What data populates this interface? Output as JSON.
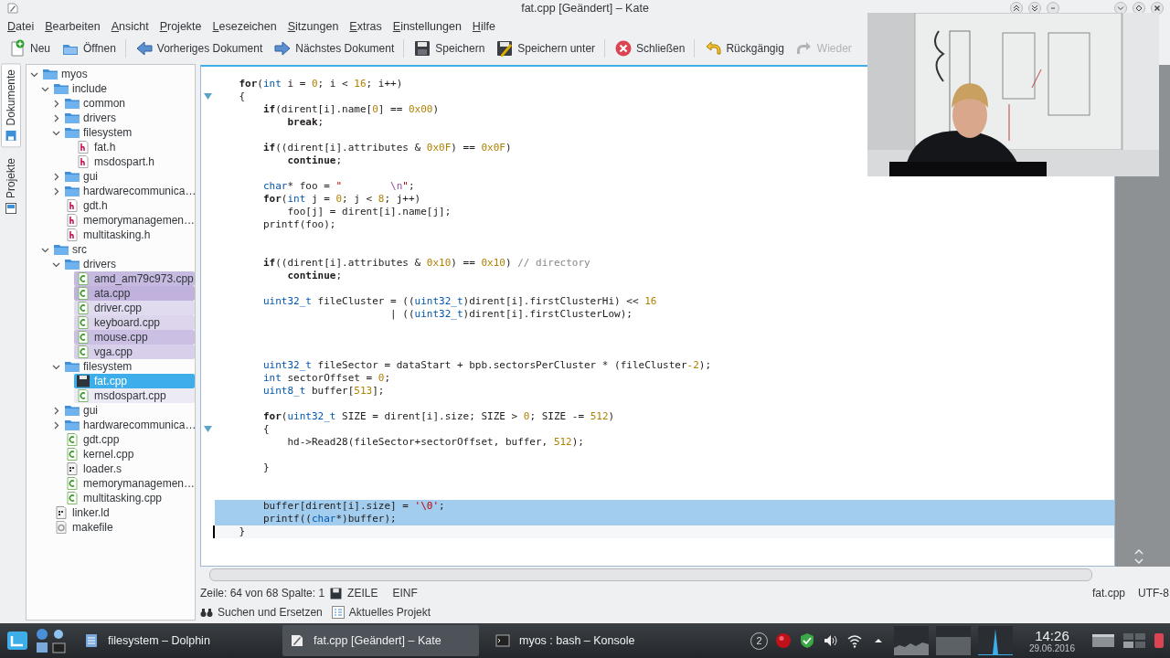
{
  "window": {
    "title": "fat.cpp [Geändert] – Kate"
  },
  "menu": [
    "Datei",
    "Bearbeiten",
    "Ansicht",
    "Projekte",
    "Lesezeichen",
    "Sitzungen",
    "Extras",
    "Einstellungen",
    "Hilfe"
  ],
  "toolbar": [
    {
      "kind": "new",
      "label": "Neu",
      "disabled": false
    },
    {
      "kind": "open",
      "label": "Öffnen",
      "disabled": false
    },
    {
      "kind": "separator"
    },
    {
      "kind": "previous",
      "label": "Vorheriges Dokument",
      "disabled": false
    },
    {
      "kind": "next",
      "label": "Nächstes Dokument",
      "disabled": false
    },
    {
      "kind": "separator"
    },
    {
      "kind": "save",
      "label": "Speichern",
      "disabled": false
    },
    {
      "kind": "save-as",
      "label": "Speichern unter",
      "disabled": false
    },
    {
      "kind": "separator"
    },
    {
      "kind": "close",
      "label": "Schließen",
      "disabled": false
    },
    {
      "kind": "separator"
    },
    {
      "kind": "undo",
      "label": "Rückgängig",
      "disabled": false
    },
    {
      "kind": "redo",
      "label": "Wieder",
      "disabled": true
    }
  ],
  "side_tabs": [
    {
      "label": "Dokumente",
      "selected": true
    },
    {
      "label": "Projekte",
      "selected": false
    }
  ],
  "tree": [
    {
      "label": "myos",
      "kind": "folder",
      "expanded": true,
      "selected": false,
      "children": [
        {
          "label": "include",
          "kind": "folder",
          "expanded": true,
          "selected": false,
          "children": [
            {
              "label": "common",
              "kind": "folder",
              "expanded": false,
              "selected": false
            },
            {
              "label": "drivers",
              "kind": "folder",
              "expanded": false,
              "selected": false
            },
            {
              "label": "filesystem",
              "kind": "folder",
              "expanded": true,
              "selected": false,
              "children": [
                {
                  "label": "fat.h",
                  "kind": "header",
                  "selected": false
                },
                {
                  "label": "msdospart.h",
                  "kind": "header",
                  "selected": false
                }
              ]
            },
            {
              "label": "gui",
              "kind": "folder",
              "expanded": false,
              "selected": false
            },
            {
              "label": "hardwarecommunica…",
              "kind": "folder",
              "expanded": false,
              "selected": false
            },
            {
              "label": "gdt.h",
              "kind": "header",
              "selected": false
            },
            {
              "label": "memorymanagemen…",
              "kind": "header",
              "selected": false
            },
            {
              "label": "multitasking.h",
              "kind": "header",
              "selected": false
            }
          ]
        },
        {
          "label": "src",
          "kind": "folder",
          "expanded": true,
          "selected": false,
          "children": [
            {
              "label": "drivers",
              "kind": "folder",
              "expanded": true,
              "selected": false,
              "children": [
                {
                  "label": "amd_am79c973.cpp",
                  "kind": "source",
                  "selected": false,
                  "color": "#c6bae0"
                },
                {
                  "label": "ata.cpp",
                  "kind": "source",
                  "selected": false,
                  "color": "#c0b2dc"
                },
                {
                  "label": "driver.cpp",
                  "kind": "source",
                  "selected": false,
                  "color": "#e0dbef"
                },
                {
                  "label": "keyboard.cpp",
                  "kind": "source",
                  "selected": false,
                  "color": "#dcd5ec"
                },
                {
                  "label": "mouse.cpp",
                  "kind": "source",
                  "selected": false,
                  "color": "#cbc0e3"
                },
                {
                  "label": "vga.cpp",
                  "kind": "source",
                  "selected": false,
                  "color": "#d8d0ea"
                }
              ]
            },
            {
              "label": "filesystem",
              "kind": "folder",
              "expanded": true,
              "selected": false,
              "children": [
                {
                  "label": "fat.cpp",
                  "kind": "modified",
                  "selected": true
                },
                {
                  "label": "msdospart.cpp",
                  "kind": "source",
                  "selected": false,
                  "color": "#eceaf5"
                }
              ]
            },
            {
              "label": "gui",
              "kind": "folder",
              "expanded": false,
              "selected": false
            },
            {
              "label": "hardwarecommunica…",
              "kind": "folder",
              "expanded": false,
              "selected": false
            },
            {
              "label": "gdt.cpp",
              "kind": "source",
              "selected": false
            },
            {
              "label": "kernel.cpp",
              "kind": "source",
              "selected": false
            },
            {
              "label": "loader.s",
              "kind": "asm",
              "selected": false
            },
            {
              "label": "memorymanagemen…",
              "kind": "source",
              "selected": false
            },
            {
              "label": "multitasking.cpp",
              "kind": "source",
              "selected": false
            }
          ]
        },
        {
          "label": "linker.ld",
          "kind": "asm",
          "selected": false
        },
        {
          "label": "makefile",
          "kind": "makefile",
          "selected": false
        }
      ]
    }
  ],
  "editor": {
    "lines": [
      {
        "kind": "code",
        "selected": false,
        "cursor": false,
        "fold": false,
        "tokens": [
          {
            "text": "    for",
            "kind": "keyword"
          },
          {
            "text": "(",
            "kind": "plain"
          },
          {
            "text": "int",
            "kind": "type"
          },
          {
            "text": " i = ",
            "kind": "plain"
          },
          {
            "text": "0",
            "kind": "number"
          },
          {
            "text": "; i < ",
            "kind": "plain"
          },
          {
            "text": "16",
            "kind": "number"
          },
          {
            "text": "; i++)",
            "kind": "plain"
          }
        ]
      },
      {
        "kind": "code",
        "selected": false,
        "cursor": false,
        "fold": true,
        "tokens": [
          {
            "text": "    {",
            "kind": "plain"
          }
        ]
      },
      {
        "kind": "code",
        "selected": false,
        "cursor": false,
        "fold": false,
        "tokens": [
          {
            "text": "        if",
            "kind": "keyword"
          },
          {
            "text": "(dirent[i].name[",
            "kind": "plain"
          },
          {
            "text": "0",
            "kind": "number"
          },
          {
            "text": "] == ",
            "kind": "plain"
          },
          {
            "text": "0x00",
            "kind": "number"
          },
          {
            "text": ")",
            "kind": "plain"
          }
        ]
      },
      {
        "kind": "code",
        "selected": false,
        "cursor": false,
        "fold": false,
        "tokens": [
          {
            "text": "            break",
            "kind": "keyword"
          },
          {
            "text": ";",
            "kind": "plain"
          }
        ]
      },
      {
        "kind": "blank",
        "selected": false,
        "cursor": false,
        "fold": false
      },
      {
        "kind": "code",
        "selected": false,
        "cursor": false,
        "fold": false,
        "tokens": [
          {
            "text": "        if",
            "kind": "keyword"
          },
          {
            "text": "((dirent[i].attributes & ",
            "kind": "plain"
          },
          {
            "text": "0x0F",
            "kind": "number"
          },
          {
            "text": ") == ",
            "kind": "plain"
          },
          {
            "text": "0x0F",
            "kind": "number"
          },
          {
            "text": ")",
            "kind": "plain"
          }
        ]
      },
      {
        "kind": "code",
        "selected": false,
        "cursor": false,
        "fold": false,
        "tokens": [
          {
            "text": "            continue",
            "kind": "keyword"
          },
          {
            "text": ";",
            "kind": "plain"
          }
        ]
      },
      {
        "kind": "blank",
        "selected": false,
        "cursor": false,
        "fold": false
      },
      {
        "kind": "code",
        "selected": false,
        "cursor": false,
        "fold": false,
        "tokens": [
          {
            "text": "        char",
            "kind": "type"
          },
          {
            "text": "* foo = ",
            "kind": "plain"
          },
          {
            "text": "\"        ",
            "kind": "string"
          },
          {
            "text": "\\n",
            "kind": "escape"
          },
          {
            "text": "\"",
            "kind": "string"
          },
          {
            "text": ";",
            "kind": "plain"
          }
        ]
      },
      {
        "kind": "code",
        "selected": false,
        "cursor": false,
        "fold": false,
        "tokens": [
          {
            "text": "        for",
            "kind": "keyword"
          },
          {
            "text": "(",
            "kind": "plain"
          },
          {
            "text": "int",
            "kind": "type"
          },
          {
            "text": " j = ",
            "kind": "plain"
          },
          {
            "text": "0",
            "kind": "number"
          },
          {
            "text": "; j < ",
            "kind": "plain"
          },
          {
            "text": "8",
            "kind": "number"
          },
          {
            "text": "; j++)",
            "kind": "plain"
          }
        ]
      },
      {
        "kind": "code",
        "selected": false,
        "cursor": false,
        "fold": false,
        "tokens": [
          {
            "text": "            foo[j] = dirent[i].name[j];",
            "kind": "plain"
          }
        ]
      },
      {
        "kind": "code",
        "selected": false,
        "cursor": false,
        "fold": false,
        "tokens": [
          {
            "text": "        printf(foo);",
            "kind": "plain"
          }
        ]
      },
      {
        "kind": "blank",
        "selected": false,
        "cursor": false,
        "fold": false
      },
      {
        "kind": "blank",
        "selected": false,
        "cursor": false,
        "fold": false
      },
      {
        "kind": "code",
        "selected": false,
        "cursor": false,
        "fold": false,
        "tokens": [
          {
            "text": "        if",
            "kind": "keyword"
          },
          {
            "text": "((dirent[i].attributes & ",
            "kind": "plain"
          },
          {
            "text": "0x10",
            "kind": "number"
          },
          {
            "text": ") == ",
            "kind": "plain"
          },
          {
            "text": "0x10",
            "kind": "number"
          },
          {
            "text": ") ",
            "kind": "plain"
          },
          {
            "text": "// directory",
            "kind": "comment"
          }
        ]
      },
      {
        "kind": "code",
        "selected": false,
        "cursor": false,
        "fold": false,
        "tokens": [
          {
            "text": "            continue",
            "kind": "keyword"
          },
          {
            "text": ";",
            "kind": "plain"
          }
        ]
      },
      {
        "kind": "blank",
        "selected": false,
        "cursor": false,
        "fold": false
      },
      {
        "kind": "code",
        "selected": false,
        "cursor": false,
        "fold": false,
        "tokens": [
          {
            "text": "        uint32_t",
            "kind": "type"
          },
          {
            "text": " fileCluster = ((",
            "kind": "plain"
          },
          {
            "text": "uint32_t",
            "kind": "type"
          },
          {
            "text": ")dirent[i].firstClusterHi) << ",
            "kind": "plain"
          },
          {
            "text": "16",
            "kind": "number"
          }
        ]
      },
      {
        "kind": "code",
        "selected": false,
        "cursor": false,
        "fold": false,
        "tokens": [
          {
            "text": "                             | ((",
            "kind": "plain"
          },
          {
            "text": "uint32_t",
            "kind": "type"
          },
          {
            "text": ")dirent[i].firstClusterLow);",
            "kind": "plain"
          }
        ]
      },
      {
        "kind": "blank",
        "selected": false,
        "cursor": false,
        "fold": false
      },
      {
        "kind": "blank",
        "selected": false,
        "cursor": false,
        "fold": false
      },
      {
        "kind": "blank",
        "selected": false,
        "cursor": false,
        "fold": false
      },
      {
        "kind": "code",
        "selected": false,
        "cursor": false,
        "fold": false,
        "tokens": [
          {
            "text": "        uint32_t",
            "kind": "type"
          },
          {
            "text": " fileSector = dataStart + bpb.sectorsPerCluster * (fileCluster",
            "kind": "plain"
          },
          {
            "text": "-2",
            "kind": "number"
          },
          {
            "text": ");",
            "kind": "plain"
          }
        ]
      },
      {
        "kind": "code",
        "selected": false,
        "cursor": false,
        "fold": false,
        "tokens": [
          {
            "text": "        int",
            "kind": "type"
          },
          {
            "text": " sectorOffset = ",
            "kind": "plain"
          },
          {
            "text": "0",
            "kind": "number"
          },
          {
            "text": ";",
            "kind": "plain"
          }
        ]
      },
      {
        "kind": "code",
        "selected": false,
        "cursor": false,
        "fold": false,
        "tokens": [
          {
            "text": "        uint8_t",
            "kind": "type"
          },
          {
            "text": " buffer[",
            "kind": "plain"
          },
          {
            "text": "513",
            "kind": "number"
          },
          {
            "text": "];",
            "kind": "plain"
          }
        ]
      },
      {
        "kind": "blank",
        "selected": false,
        "cursor": false,
        "fold": false
      },
      {
        "kind": "code",
        "selected": false,
        "cursor": false,
        "fold": false,
        "tokens": [
          {
            "text": "        for",
            "kind": "keyword"
          },
          {
            "text": "(",
            "kind": "plain"
          },
          {
            "text": "uint32_t",
            "kind": "type"
          },
          {
            "text": " SIZE = dirent[i].size; SIZE > ",
            "kind": "plain"
          },
          {
            "text": "0",
            "kind": "number"
          },
          {
            "text": "; SIZE -= ",
            "kind": "plain"
          },
          {
            "text": "512",
            "kind": "number"
          },
          {
            "text": ")",
            "kind": "plain"
          }
        ]
      },
      {
        "kind": "code",
        "selected": false,
        "cursor": false,
        "fold": true,
        "tokens": [
          {
            "text": "        {",
            "kind": "plain"
          }
        ]
      },
      {
        "kind": "code",
        "selected": false,
        "cursor": false,
        "fold": false,
        "tokens": [
          {
            "text": "            hd->Read28(fileSector+sectorOffset, buffer, ",
            "kind": "plain"
          },
          {
            "text": "512",
            "kind": "number"
          },
          {
            "text": ");",
            "kind": "plain"
          }
        ]
      },
      {
        "kind": "blank",
        "selected": false,
        "cursor": false,
        "fold": false
      },
      {
        "kind": "code",
        "selected": false,
        "cursor": false,
        "fold": false,
        "tokens": [
          {
            "text": "        }",
            "kind": "plain"
          }
        ]
      },
      {
        "kind": "blank",
        "selected": false,
        "cursor": false,
        "fold": false
      },
      {
        "kind": "blank",
        "selected": false,
        "cursor": false,
        "fold": false
      },
      {
        "kind": "code",
        "selected": true,
        "cursor": false,
        "fold": false,
        "tokens": [
          {
            "text": "        buffer[dirent[i].size] = ",
            "kind": "plain"
          },
          {
            "text": "'\\0'",
            "kind": "string"
          },
          {
            "text": ";",
            "kind": "plain"
          }
        ]
      },
      {
        "kind": "code",
        "selected": true,
        "cursor": false,
        "fold": false,
        "tokens": [
          {
            "text": "        printf((",
            "kind": "plain"
          },
          {
            "text": "char",
            "kind": "type"
          },
          {
            "text": "*)buffer);",
            "kind": "plain"
          }
        ]
      },
      {
        "kind": "code",
        "selected": false,
        "cursor": true,
        "fold": false,
        "tokens": [
          {
            "text": "    }",
            "kind": "plain"
          }
        ]
      }
    ]
  },
  "status_bar": {
    "position": "Zeile: 64 von 68 Spalte: 1",
    "modified": true,
    "mode": "ZEILE",
    "insert": "EINF",
    "file": "fat.cpp",
    "encoding": "UTF-8"
  },
  "bottom_tabs": [
    {
      "kind": "search",
      "label": "Suchen und Ersetzen"
    },
    {
      "kind": "project",
      "label": "Aktuelles Projekt"
    }
  ],
  "taskbar": {
    "tasks": [
      {
        "kind": "files",
        "label": "filesystem – Dolphin",
        "selected": false
      },
      {
        "kind": "editor",
        "label": "fat.cpp [Geändert] – Kate",
        "selected": true
      },
      {
        "kind": "terminal",
        "label": "myos : bash – Konsole",
        "selected": false
      }
    ],
    "tray_badge": "2",
    "time": "14:26",
    "date": "29.06.2016"
  }
}
